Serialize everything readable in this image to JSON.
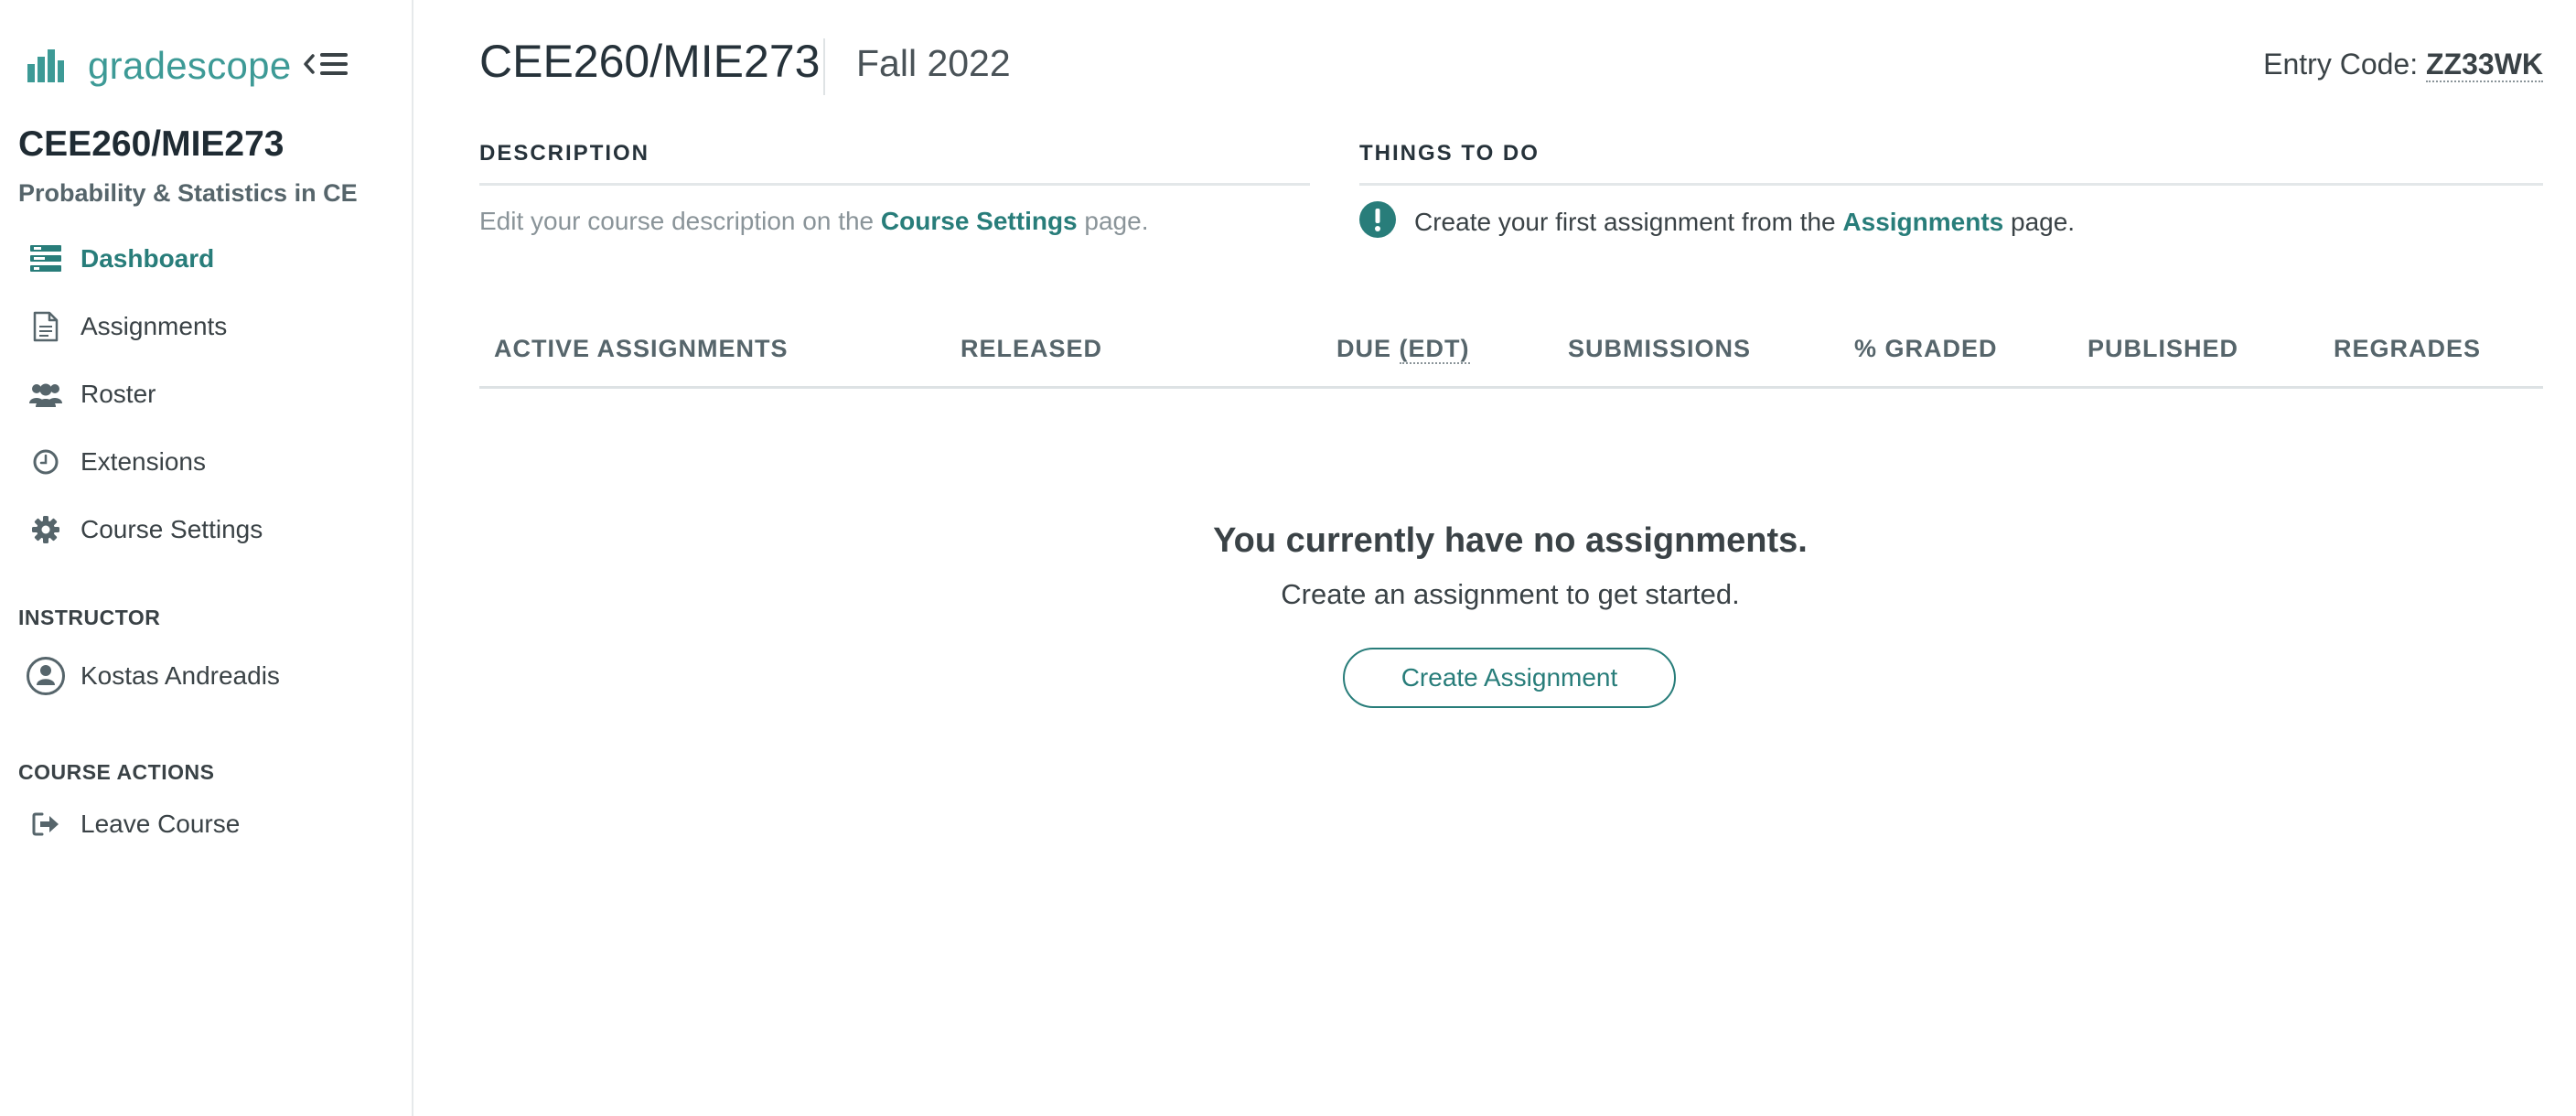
{
  "brand": {
    "name": "gradescope",
    "logo_icon": "bar-chart-icon",
    "accent": "#3d9a96"
  },
  "sidebar": {
    "course_code": "CEE260/MIE273",
    "course_name": "Probability & Statistics in CE",
    "items": [
      {
        "label": "Dashboard",
        "icon": "dashboard-icon",
        "active": true
      },
      {
        "label": "Assignments",
        "icon": "document-icon",
        "active": false
      },
      {
        "label": "Roster",
        "icon": "users-icon",
        "active": false
      },
      {
        "label": "Extensions",
        "icon": "clock-icon",
        "active": false
      },
      {
        "label": "Course Settings",
        "icon": "gear-icon",
        "active": false
      }
    ],
    "instructor_heading": "INSTRUCTOR",
    "instructor_name": "Kostas Andreadis",
    "actions_heading": "COURSE ACTIONS",
    "leave_course": "Leave Course"
  },
  "header": {
    "title": "CEE260/MIE273",
    "term": "Fall 2022",
    "entry_code_label": "Entry Code: ",
    "entry_code": "ZZ33WK"
  },
  "description": {
    "heading": "DESCRIPTION",
    "text_before": "Edit your course description on the ",
    "link": "Course Settings",
    "text_after": " page."
  },
  "todo": {
    "heading": "THINGS TO DO",
    "text_before": "Create your first assignment from the ",
    "link": "Assignments",
    "text_after": " page."
  },
  "table": {
    "col_active": "ACTIVE ASSIGNMENTS",
    "col_released": "RELEASED",
    "col_due": "DUE",
    "col_due_tz": "(EDT)",
    "col_submissions": "SUBMISSIONS",
    "col_graded": "% GRADED",
    "col_published": "PUBLISHED",
    "col_regrades": "REGRADES"
  },
  "empty_state": {
    "title": "You currently have no assignments.",
    "subtitle": "Create an assignment to get started.",
    "button": "Create Assignment"
  },
  "colors": {
    "teal": "#287d7a",
    "text": "#3a4246",
    "muted": "#8a9499"
  }
}
